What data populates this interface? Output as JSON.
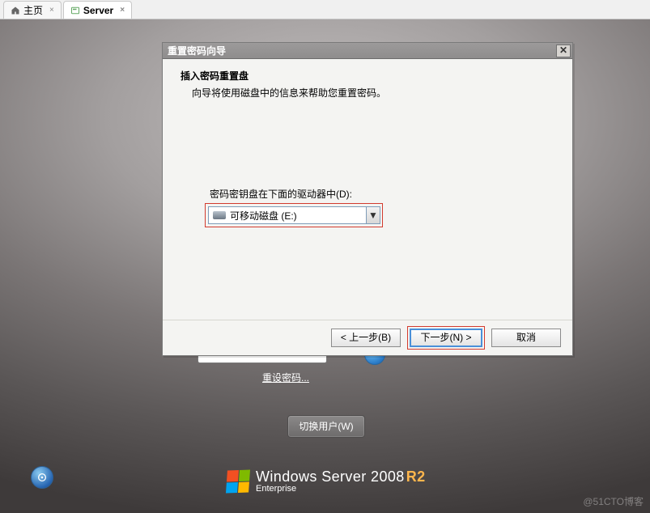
{
  "tabs": [
    {
      "label": "主页"
    },
    {
      "label": "Server"
    }
  ],
  "login": {
    "reset_link": "重设密码...",
    "switch_user": "切换用户(W)"
  },
  "branding": {
    "line1_pre": "Windows Server",
    "year": " 2008",
    "r2": "R2",
    "line2": "Enterprise"
  },
  "watermark": "@51CTO博客",
  "dialog": {
    "title": "重置密码向导",
    "heading": "插入密码重置盘",
    "subheading": "向导将使用磁盘中的信息来帮助您重置密码。",
    "field_label": "密码密钥盘在下面的驱动器中(D):",
    "combo_value": "可移动磁盘 (E:)",
    "back": "< 上一步(B)",
    "next": "下一步(N) >",
    "cancel": "取消"
  }
}
